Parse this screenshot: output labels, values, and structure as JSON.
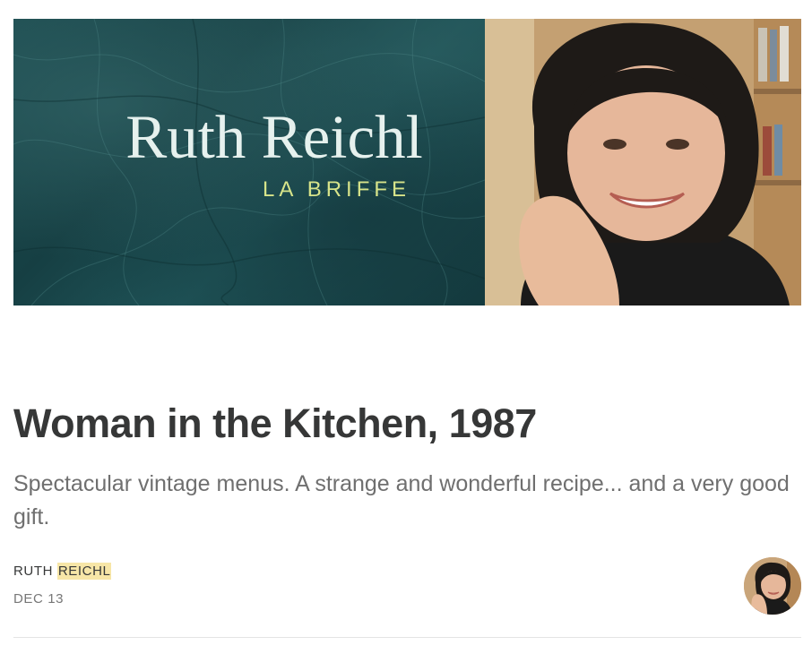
{
  "hero": {
    "title": "Ruth Reichl",
    "subtitle": "LA BRIFFE",
    "colors": {
      "marble": "#1d4c50",
      "title": "#e6f1ee",
      "subtitle": "#d7e48a"
    }
  },
  "post": {
    "title": "Woman in the Kitchen, 1987",
    "subtitle": "Spectacular vintage menus. A strange and wonderful recipe... and a very good gift.",
    "author_first": "RUTH",
    "author_last": "REICHL",
    "date": "DEC 13"
  },
  "colors": {
    "text": "#363737",
    "muted": "#6f6f6f",
    "highlight": "#f7e6a7"
  }
}
